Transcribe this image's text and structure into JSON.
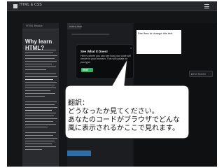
{
  "app": {
    "title": "HTML & CSS"
  },
  "lesson": {
    "breadcrumb": "HTML Basics",
    "title": "Why learn HTML?"
  },
  "editor": {
    "tab_label": "index.html"
  },
  "preview": {
    "content_text": "Feel free to change this text.",
    "button_label": "Full Screen"
  },
  "tooltip": {
    "title": "See What It Does!",
    "body": "Here's where you can see how your code will render in your browser. This will update as you type.",
    "close_label": "×",
    "next_label": "Next"
  },
  "note": {
    "line1": "翻訳：",
    "line2": "どうなったか見てください。",
    "line3": "あなたのコードがブラウザでどんな",
    "line4": "風に表示されるかここで見れます。"
  },
  "colors": {
    "dark_bg": "#141517",
    "next_button": "#33b06a",
    "bottom_button": "#2c6fa8"
  }
}
